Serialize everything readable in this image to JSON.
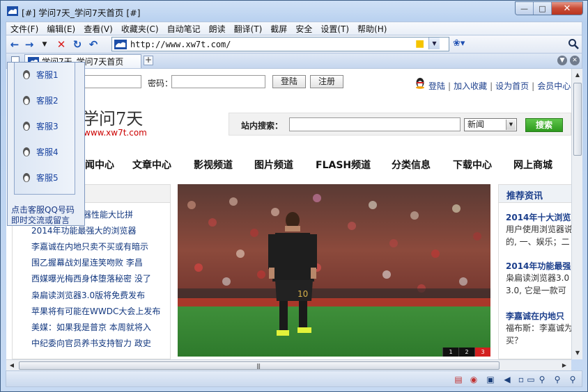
{
  "window": {
    "title": "[#] 学问7天_学问7天首页 [#]",
    "buttons": {
      "minimize": "—",
      "maximize": "□",
      "close": "✕"
    }
  },
  "menu": [
    "文件(F)",
    "编辑(E)",
    "查看(V)",
    "收藏夹(C)",
    "自动笔记",
    "朗读",
    "翻译(T)",
    "截屏",
    "安全",
    "设置(T)",
    "帮助(H)"
  ],
  "toolbar": {
    "address": "http://www.xw7t.com/",
    "icons": [
      "back-arrow-icon",
      "forward-arrow-icon",
      "dropdown-icon",
      "stop-icon",
      "refresh-icon",
      "undo-icon"
    ]
  },
  "tabs": [
    {
      "label": "学问7天_学问7天首页"
    }
  ],
  "page": {
    "login": {
      "password_label": "密码：",
      "login_button": "登陆",
      "register_button": "注册"
    },
    "top_links": [
      "登陆",
      "加入收藏",
      "设为首页",
      "会员中心"
    ],
    "site_name": "学问7天",
    "site_url": "www.xw7t.com",
    "search": {
      "label": "站内搜索：",
      "category": "新闻",
      "button": "搜索"
    },
    "nav": [
      "闻中心",
      "文章中心",
      "影视频道",
      "图片频道",
      "FLASH频道",
      "分类信息",
      "下载中心",
      "网上商城"
    ],
    "news": [
      "览器性能大比拼",
      "2014年功能最强大的浏览器",
      "李嘉诚在内地只卖不买或有暗示",
      "围乙握幕战刘星连笑吻败 李昌",
      "西媒曝光梅西身体堕落秘密 没了",
      "枭扁读浏览器3.0版将免费发布",
      "苹果将有可能在WWDC大会上发布",
      "美媒：如果我是普京 本周就将入",
      "中纪委向官员养书支持智力 政史"
    ],
    "slides": [
      "1",
      "2",
      "3"
    ],
    "recommend": {
      "title": "推荐资讯",
      "items": [
        {
          "title": "2014年十大浏览",
          "desc": [
            "用户使用浏览器说",
            "的, 一、娱乐；二"
          ]
        },
        {
          "title": "2014年功能最强",
          "desc": [
            "枭扁读浏览器3.0",
            "3.0, 它是一款可"
          ]
        },
        {
          "title": "李嘉诚在内地只",
          "desc": [
            "福布斯：李嘉诚为",
            "买？"
          ]
        }
      ]
    },
    "customer_service": {
      "items": [
        "客服1",
        "客服2",
        "客服3",
        "客服4",
        "客服5"
      ],
      "note": [
        "点击客服QQ号码",
        "即时交流或留言"
      ]
    }
  },
  "colors": {
    "link": "#1c3f8c",
    "search_button": "#2d9a1e",
    "site_url": "#cc0000",
    "slide_active": "#d32020"
  }
}
